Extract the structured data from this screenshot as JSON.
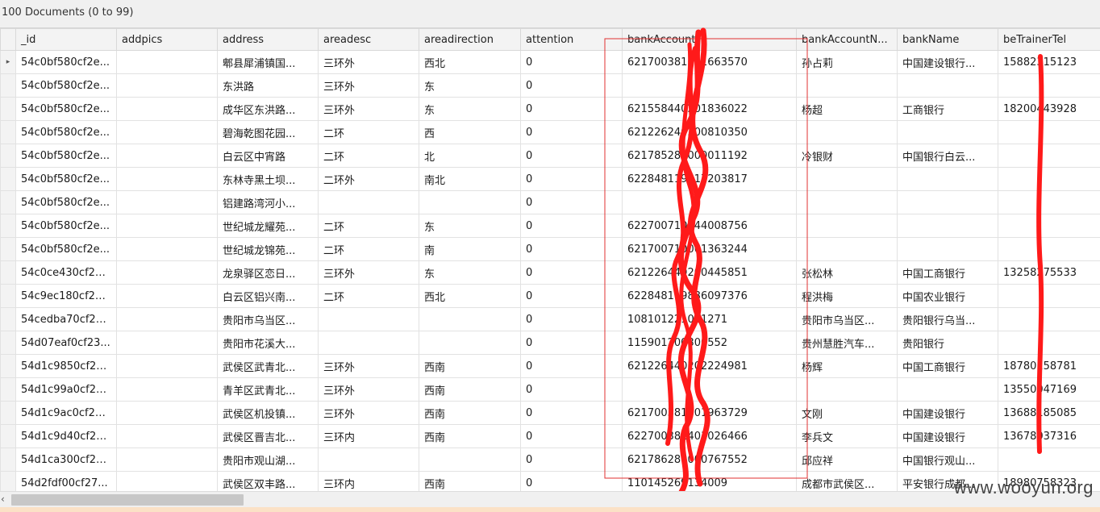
{
  "status": {
    "doc_count": "100 Documents (0 to 99)"
  },
  "columns": [
    "_id",
    "addpics",
    "address",
    "areadesc",
    "areadirection",
    "attention",
    "bankAccount",
    "bankAccountN...",
    "bankName",
    "beTrainerTel"
  ],
  "current_row_marker": "▸",
  "rows": [
    [
      "54c0bf580cf2e...",
      "",
      "郫县犀浦镇国...",
      "三环外",
      "西北",
      "0",
      "621700381001663570",
      "孙占莉",
      "中国建设银行...",
      "15882315123"
    ],
    [
      "54c0bf580cf2e...",
      "",
      "东洪路",
      "三环外",
      "东",
      "0",
      "",
      "",
      "",
      ""
    ],
    [
      "54c0bf580cf2e...",
      "",
      "成华区东洪路...",
      "三环外",
      "东",
      "0",
      "621558440201836022",
      "杨超",
      "工商银行",
      "18200443928"
    ],
    [
      "54c0bf580cf2e...",
      "",
      "碧海乾图花园...",
      "二环",
      "西",
      "0",
      "621226240200810350",
      "",
      "",
      ""
    ],
    [
      "54c0bf580cf2e...",
      "",
      "白云区中宵路",
      "二环",
      "北",
      "0",
      "621785280000011192",
      "冷银财",
      "中国银行白云...",
      ""
    ],
    [
      "54c0bf580cf2e...",
      "",
      "东林寺黑土坝...",
      "二环外",
      "南北",
      "0",
      "622848119617203817",
      "",
      "",
      ""
    ],
    [
      "54c0bf580cf2e...",
      "",
      "铝建路湾河小...",
      "",
      "",
      "0",
      "",
      "",
      "",
      ""
    ],
    [
      "54c0bf580cf2e...",
      "",
      "世纪城龙耀苑...",
      "二环",
      "东",
      "0",
      "622700710244008756",
      "",
      "",
      ""
    ],
    [
      "54c0bf580cf2e...",
      "",
      "世纪城龙锦苑...",
      "二环",
      "南",
      "0",
      "621700710001363244",
      "",
      "",
      ""
    ],
    [
      "54c0ce430cf29...",
      "",
      "龙泉驿区恋日...",
      "三环外",
      "东",
      "0",
      "621226440200445851",
      "张松林",
      "中国工商银行",
      "13258275533"
    ],
    [
      "54c9ec180cf2d...",
      "",
      "白云区铝兴南...",
      "二环",
      "西北",
      "0",
      "622848119836097376",
      "程洪梅",
      "中国农业银行",
      ""
    ],
    [
      "54cedba70cf25...",
      "",
      "贵阳市乌当区...",
      "",
      "",
      "0",
      "108101221001271",
      "贵阳市乌当区...",
      "贵阳银行乌当...",
      ""
    ],
    [
      "54d07eaf0cf23...",
      "",
      "贵阳市花溪大...",
      "",
      "",
      "0",
      "115901200300552",
      "贵州慧胜汽车...",
      "贵阳银行",
      ""
    ],
    [
      "54d1c9850cf23...",
      "",
      "武侯区武青北...",
      "三环外",
      "西南",
      "0",
      "621226440202224981",
      "杨辉",
      "中国工商银行",
      "18780158781"
    ],
    [
      "54d1c99a0cf23...",
      "",
      "青羊区武青北...",
      "三环外",
      "西南",
      "0",
      "",
      "",
      "",
      "13550047169"
    ],
    [
      "54d1c9ac0cf23...",
      "",
      "武侯区机投镇...",
      "三环外",
      "西南",
      "0",
      "621700381001963729",
      "文刚",
      "中国建设银行",
      "13688185085"
    ],
    [
      "54d1c9d40cf23...",
      "",
      "武侯区晋吉北...",
      "三环内",
      "西南",
      "0",
      "622700381401026466",
      "李兵文",
      "中国建设银行",
      "13678037316"
    ],
    [
      "54d1ca300cf23...",
      "",
      "贵阳市观山湖...",
      "",
      "",
      "0",
      "621786280000767552",
      "邱应祥",
      "中国银行观山...",
      ""
    ],
    [
      "54d2fdf00cf27...",
      "",
      "武侯区双丰路...",
      "三环内",
      "西南",
      "0",
      "110145269134009",
      "成都市武侯区...",
      "平安银行成都...",
      "18980758323"
    ]
  ],
  "scrollbar": {
    "left_arrow": "‹"
  },
  "watermark": "www.wooyun.org",
  "colors": {
    "redaction": "#ff1a1a"
  }
}
